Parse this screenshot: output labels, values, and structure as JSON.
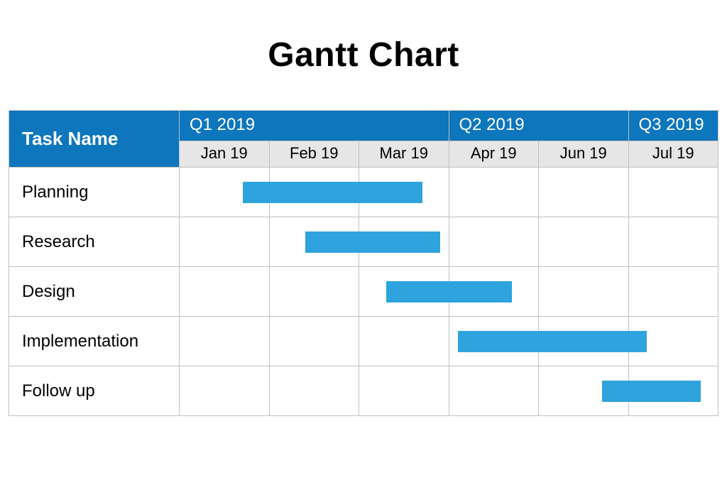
{
  "title": "Gantt Chart",
  "header": {
    "task_name_label": "Task Name",
    "quarters": [
      {
        "label": "Q1 2019",
        "span": 3
      },
      {
        "label": "Q2 2019",
        "span": 2
      },
      {
        "label": "Q3 2019",
        "span": 1
      }
    ],
    "months": [
      "Jan 19",
      "Feb 19",
      "Mar 19",
      "Apr 19",
      "Jun 19",
      "Jul 19"
    ]
  },
  "tasks": [
    {
      "name": "Planning",
      "start": 0.7,
      "end": 2.7
    },
    {
      "name": "Research",
      "start": 1.4,
      "end": 2.9
    },
    {
      "name": "Design",
      "start": 2.3,
      "end": 3.7
    },
    {
      "name": "Implementation",
      "start": 3.1,
      "end": 5.2
    },
    {
      "name": "Follow up",
      "start": 4.7,
      "end": 5.8
    }
  ],
  "colors": {
    "header_bg": "#0e76bc",
    "month_bg": "#e6e6e6",
    "bar": "#2ea3dd",
    "grid": "#bfbfbf"
  },
  "chart_data": {
    "type": "bar",
    "title": "Gantt Chart",
    "x_axis": {
      "months": [
        "Jan 19",
        "Feb 19",
        "Mar 19",
        "Apr 19",
        "Jun 19",
        "Jul 19"
      ],
      "quarters": [
        "Q1 2019",
        "Q1 2019",
        "Q1 2019",
        "Q2 2019",
        "Q2 2019",
        "Q3 2019"
      ]
    },
    "series": [
      {
        "name": "Planning",
        "start_month_index": 0.7,
        "end_month_index": 2.7
      },
      {
        "name": "Research",
        "start_month_index": 1.4,
        "end_month_index": 2.9
      },
      {
        "name": "Design",
        "start_month_index": 2.3,
        "end_month_index": 3.7
      },
      {
        "name": "Implementation",
        "start_month_index": 3.1,
        "end_month_index": 5.2
      },
      {
        "name": "Follow up",
        "start_month_index": 4.7,
        "end_month_index": 5.8
      }
    ],
    "xlim": [
      0,
      6
    ]
  }
}
